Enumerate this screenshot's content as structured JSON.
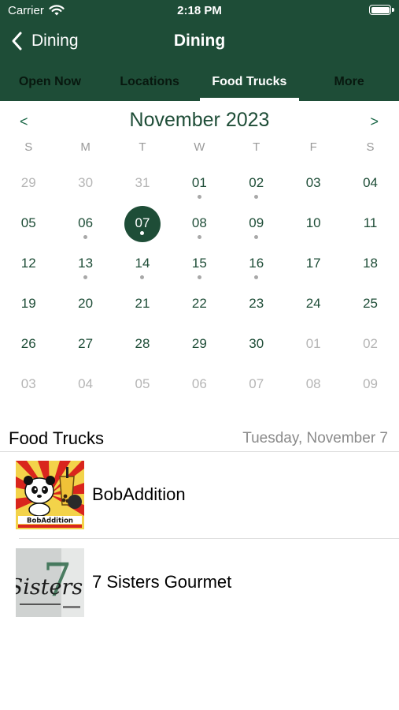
{
  "status_bar": {
    "carrier": "Carrier",
    "time": "2:18 PM"
  },
  "nav": {
    "back_label": "Dining",
    "title": "Dining"
  },
  "tabs": [
    {
      "label": "Open Now",
      "active": false
    },
    {
      "label": "Locations",
      "active": false
    },
    {
      "label": "Food Trucks",
      "active": true
    },
    {
      "label": "More",
      "active": false
    }
  ],
  "calendar": {
    "prev": "<",
    "next": ">",
    "month_title": "November 2023",
    "weekdays": [
      "S",
      "M",
      "T",
      "W",
      "T",
      "F",
      "S"
    ],
    "days": [
      {
        "label": "29",
        "muted": true
      },
      {
        "label": "30",
        "muted": true
      },
      {
        "label": "31",
        "muted": true
      },
      {
        "label": "01",
        "dot": true
      },
      {
        "label": "02",
        "dot": true
      },
      {
        "label": "03"
      },
      {
        "label": "04"
      },
      {
        "label": "05"
      },
      {
        "label": "06",
        "dot": true
      },
      {
        "label": "07",
        "dot": true,
        "selected": true
      },
      {
        "label": "08",
        "dot": true
      },
      {
        "label": "09",
        "dot": true
      },
      {
        "label": "10"
      },
      {
        "label": "11"
      },
      {
        "label": "12"
      },
      {
        "label": "13",
        "dot": true
      },
      {
        "label": "14",
        "dot": true
      },
      {
        "label": "15",
        "dot": true
      },
      {
        "label": "16",
        "dot": true
      },
      {
        "label": "17"
      },
      {
        "label": "18"
      },
      {
        "label": "19"
      },
      {
        "label": "20"
      },
      {
        "label": "21"
      },
      {
        "label": "22"
      },
      {
        "label": "23"
      },
      {
        "label": "24"
      },
      {
        "label": "25"
      },
      {
        "label": "26"
      },
      {
        "label": "27"
      },
      {
        "label": "28"
      },
      {
        "label": "29"
      },
      {
        "label": "30"
      },
      {
        "label": "01",
        "muted": true
      },
      {
        "label": "02",
        "muted": true
      },
      {
        "label": "03",
        "muted": true
      },
      {
        "label": "04",
        "muted": true
      },
      {
        "label": "05",
        "muted": true
      },
      {
        "label": "06",
        "muted": true
      },
      {
        "label": "07",
        "muted": true
      },
      {
        "label": "08",
        "muted": true
      },
      {
        "label": "09",
        "muted": true
      }
    ]
  },
  "section": {
    "title": "Food Trucks",
    "date": "Tuesday, November 7"
  },
  "trucks": [
    {
      "name": "BobAddition",
      "logo_text": "BobAddition",
      "icon": "panda-logo-icon"
    },
    {
      "name": "7 Sisters Gourmet",
      "logo_text": "Sisters",
      "logo_numeral": "7",
      "icon": "sisters-logo-icon"
    }
  ],
  "colors": {
    "brand": "#1e4d37",
    "accent": "#1e6a4a",
    "muted_text": "#b5b5b5",
    "event_dot": "#a8a8a8"
  }
}
